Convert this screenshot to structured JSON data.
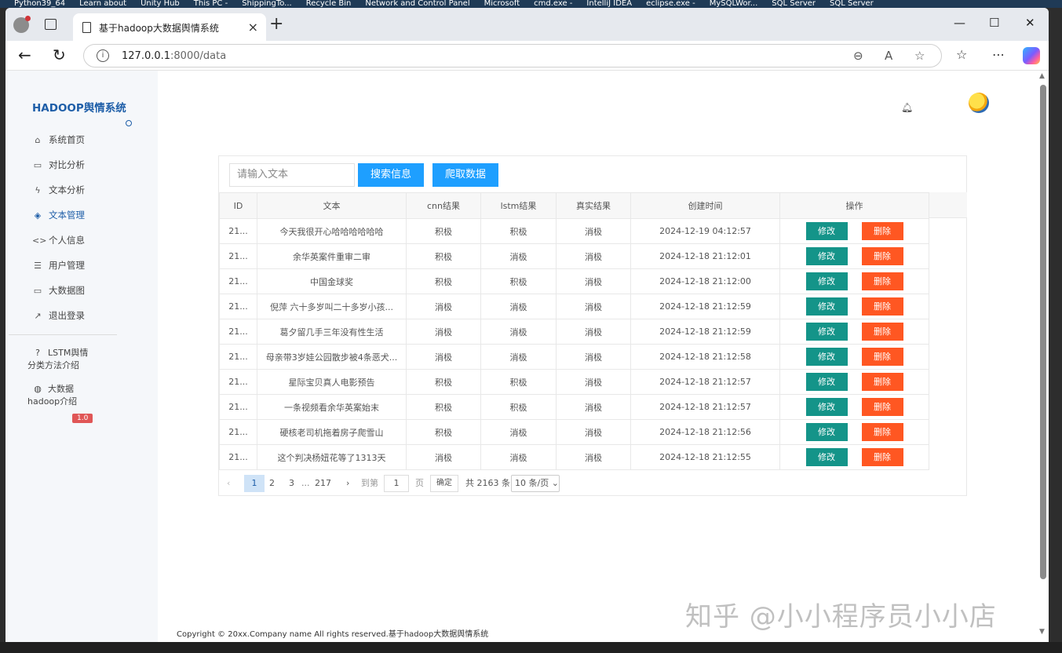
{
  "desktop": {
    "taskbar_items": [
      "Python39_64",
      "Learn about",
      "Unity Hub",
      "This PC -",
      "ShippingTo...",
      "Recycle Bin",
      "Network and Control Panel",
      "Microsoft",
      "cmd.exe -",
      "IntelliJ IDEA",
      "eclipse.exe -",
      "MySQLWor...",
      "SQL Server",
      "SQL Server"
    ]
  },
  "browser": {
    "tab_title": "基于hadoop大数据舆情系统",
    "url_host": "127.0.0.1",
    "url_rest": ":8000/data"
  },
  "sidebar": {
    "brand": "HADOOP舆情系统",
    "items": [
      {
        "label": "系统首页",
        "icon": "home-icon",
        "glyph": "⌂"
      },
      {
        "label": "对比分析",
        "icon": "monitor-icon",
        "glyph": "▭"
      },
      {
        "label": "文本分析",
        "icon": "lightning-icon",
        "glyph": "ϟ"
      },
      {
        "label": "文本管理",
        "icon": "layers-icon",
        "glyph": "◈"
      },
      {
        "label": "个人信息",
        "icon": "code-icon",
        "glyph": "<>"
      },
      {
        "label": "用户管理",
        "icon": "list-icon",
        "glyph": "☰"
      },
      {
        "label": "大数据图",
        "icon": "monitor-icon",
        "glyph": "▭"
      },
      {
        "label": "退出登录",
        "icon": "trend-icon",
        "glyph": "↗"
      }
    ],
    "active_index": 3,
    "extra": [
      {
        "line1": "LSTM舆情",
        "line2": "分类方法介绍",
        "icon": "help-icon",
        "glyph": "?"
      },
      {
        "line1": "大数据",
        "line2": "hadoop介绍",
        "icon": "globe-icon",
        "glyph": "◍"
      }
    ],
    "version_badge": "1.0"
  },
  "toolbar": {
    "search_placeholder": "请输入文本",
    "search_button": "搜索信息",
    "crawl_button": "爬取数据"
  },
  "table": {
    "headers": [
      "ID",
      "文本",
      "cnn结果",
      "lstm结果",
      "真实结果",
      "创建时间",
      "操作"
    ],
    "edit_label": "修改",
    "delete_label": "删除",
    "rows": [
      {
        "id": "21...",
        "text": "今天我很开心哈哈哈哈哈哈",
        "cnn": "积极",
        "lstm": "积极",
        "real": "消极",
        "time": "2024-12-19 04:12:57"
      },
      {
        "id": "21...",
        "text": "余华英案件重审二审",
        "cnn": "积极",
        "lstm": "消极",
        "real": "消极",
        "time": "2024-12-18 21:12:01"
      },
      {
        "id": "21...",
        "text": "中国金球奖",
        "cnn": "积极",
        "lstm": "积极",
        "real": "消极",
        "time": "2024-12-18 21:12:00"
      },
      {
        "id": "21...",
        "text": "倪萍 六十多岁叫二十多岁小孩...",
        "cnn": "消极",
        "lstm": "消极",
        "real": "消极",
        "time": "2024-12-18 21:12:59"
      },
      {
        "id": "21...",
        "text": "葛夕留几手三年没有性生活",
        "cnn": "消极",
        "lstm": "消极",
        "real": "消极",
        "time": "2024-12-18 21:12:59"
      },
      {
        "id": "21...",
        "text": "母亲带3岁娃公园散步被4条恶犬...",
        "cnn": "消极",
        "lstm": "消极",
        "real": "消极",
        "time": "2024-12-18 21:12:58"
      },
      {
        "id": "21...",
        "text": "星际宝贝真人电影预告",
        "cnn": "积极",
        "lstm": "积极",
        "real": "消极",
        "time": "2024-12-18 21:12:57"
      },
      {
        "id": "21...",
        "text": "一条视频看余华英案始末",
        "cnn": "积极",
        "lstm": "积极",
        "real": "消极",
        "time": "2024-12-18 21:12:57"
      },
      {
        "id": "21...",
        "text": "硬核老司机拖着房子爬雪山",
        "cnn": "积极",
        "lstm": "消极",
        "real": "消极",
        "time": "2024-12-18 21:12:56"
      },
      {
        "id": "21...",
        "text": "这个判决杨妞花等了1313天",
        "cnn": "消极",
        "lstm": "消极",
        "real": "消极",
        "time": "2024-12-18 21:12:55"
      }
    ]
  },
  "pager": {
    "prev": "‹",
    "pages": [
      "1",
      "2",
      "3"
    ],
    "ellipsis": "...",
    "last_page": "217",
    "next": "›",
    "goto_label": "到第",
    "goto_value": "1",
    "page_unit": "页",
    "confirm": "确定",
    "total": "共 2163 条",
    "per_page": "10 条/页"
  },
  "footer": "Copyright © 20xx.Company name All rights reserved.基于hadoop大数据舆情系统",
  "watermark": "知乎 @小小程序员小小店"
}
